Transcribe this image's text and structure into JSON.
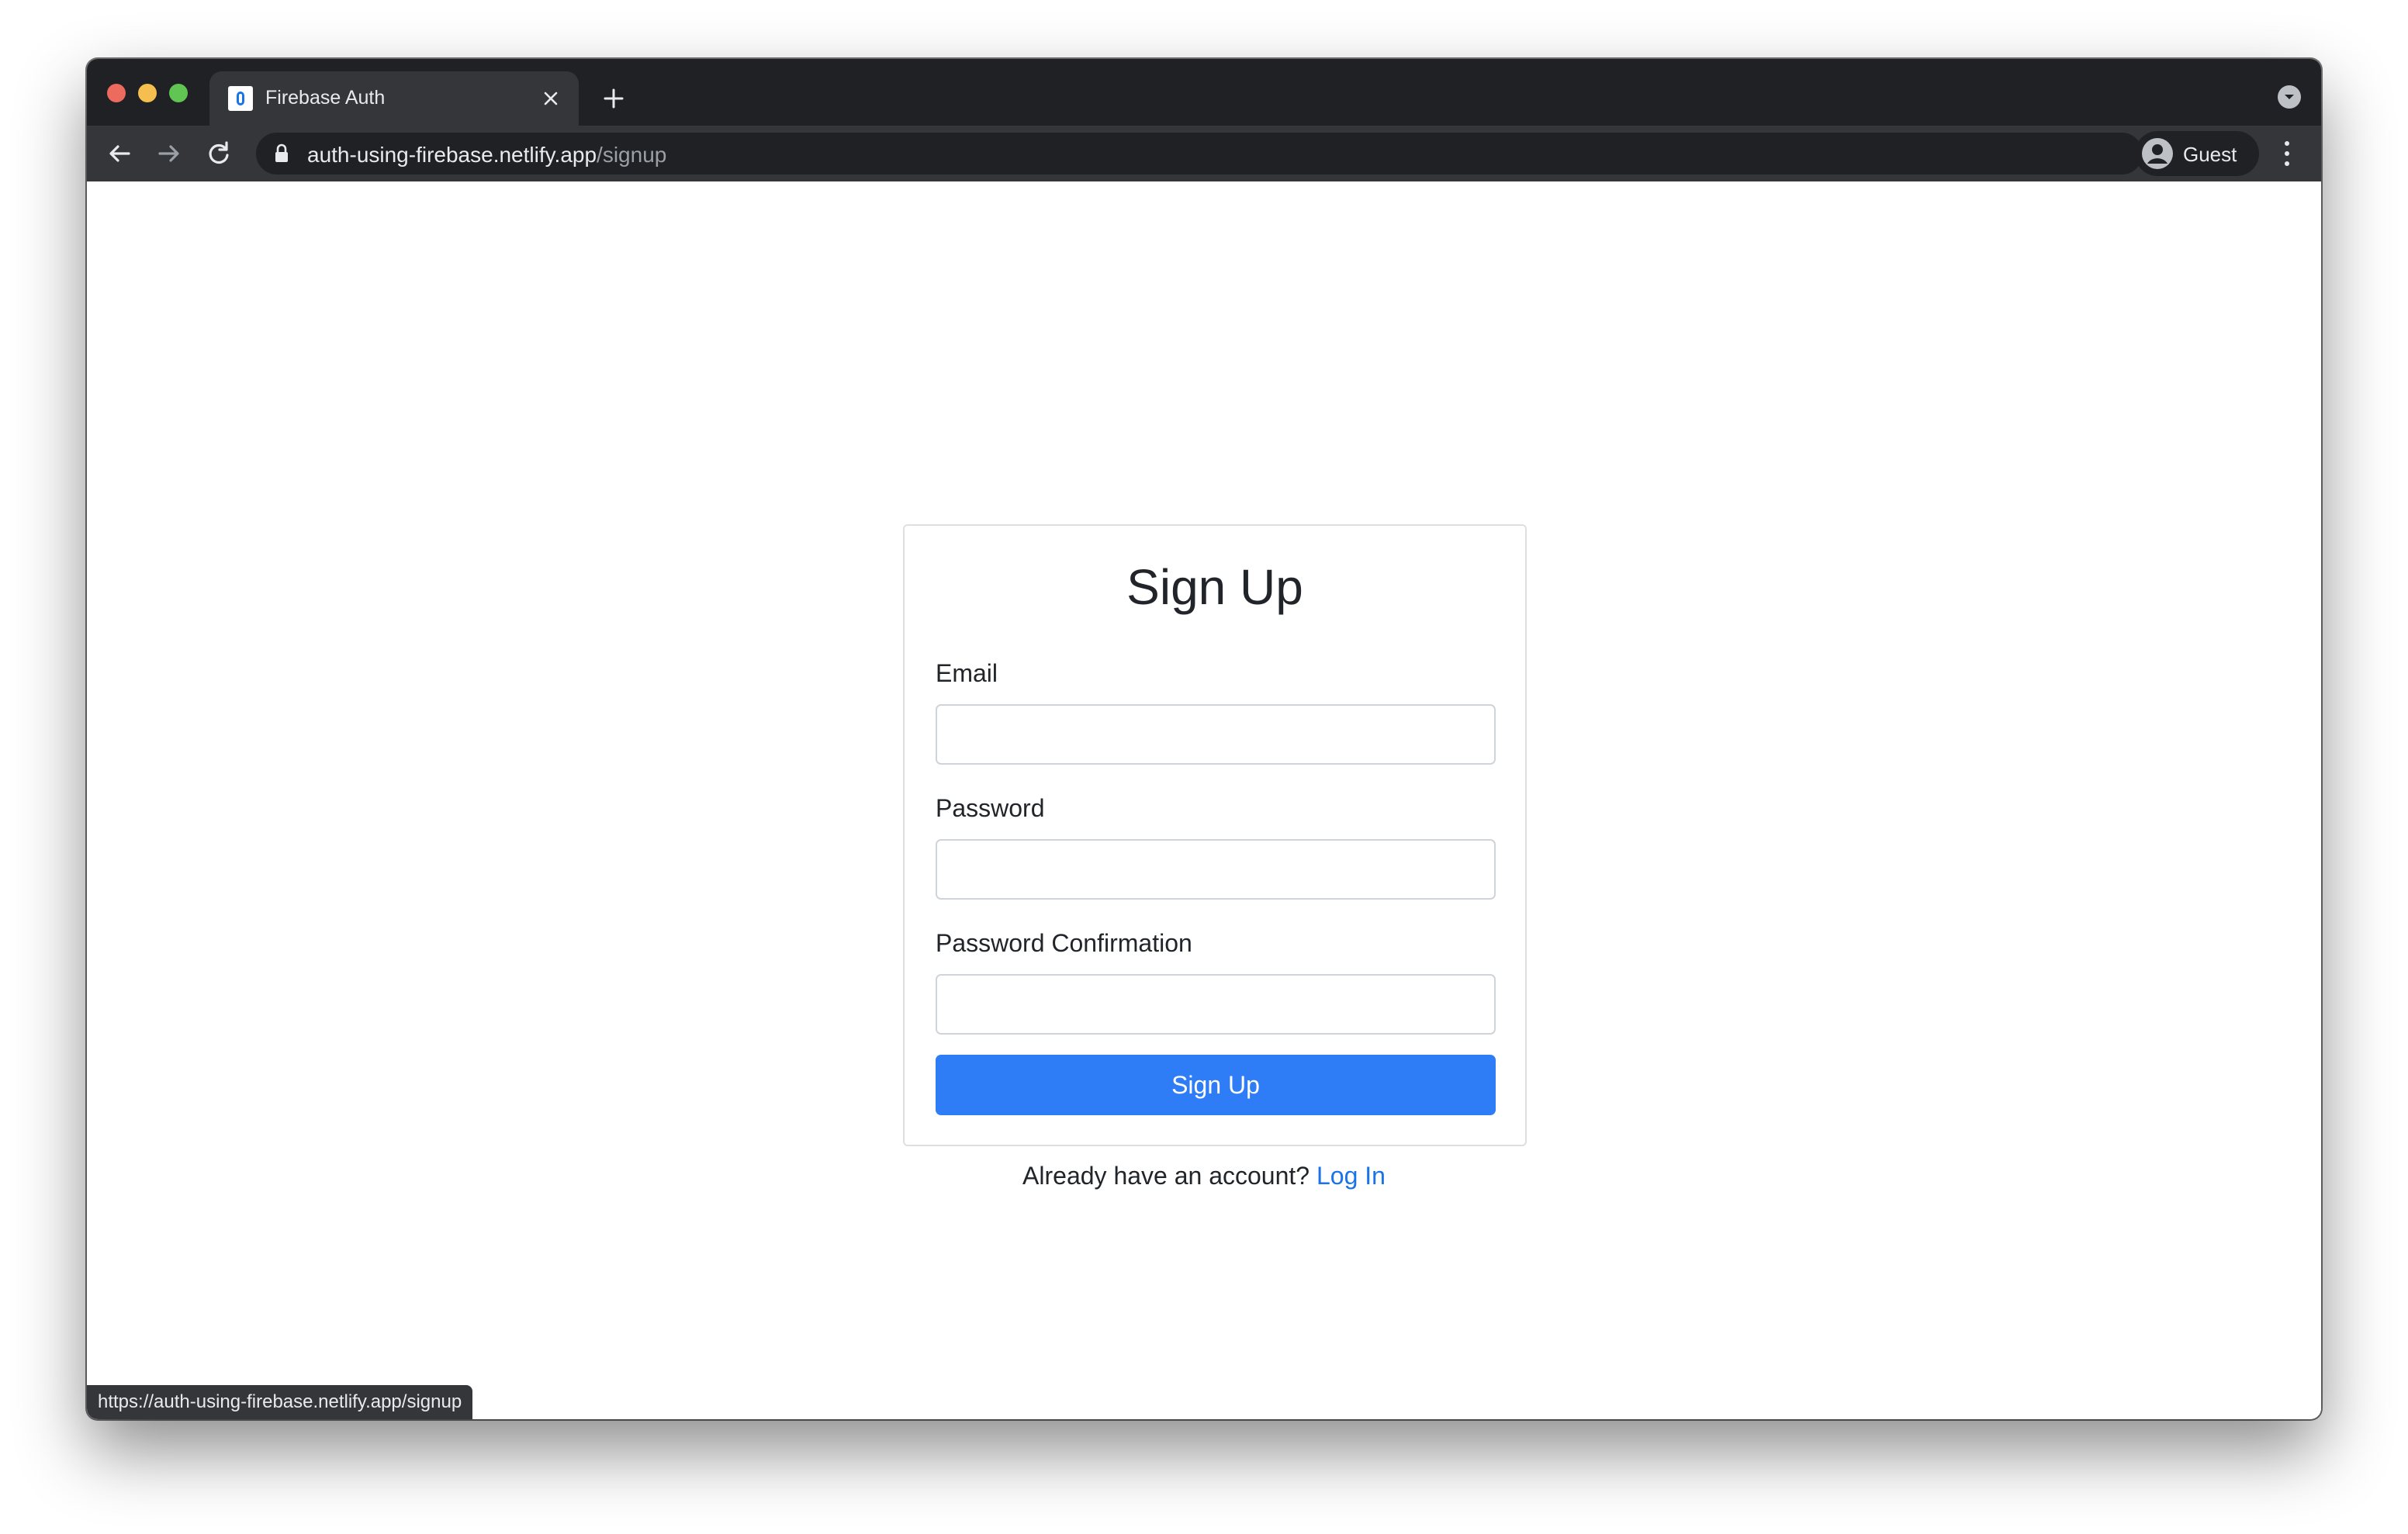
{
  "browser": {
    "tab": {
      "title": "Firebase Auth",
      "favicon": "firebase-favicon-icon"
    },
    "omnibox": {
      "host": "auth-using-firebase.netlify.app",
      "path": "/signup"
    },
    "profile": {
      "label": "Guest"
    },
    "status_url": "https://auth-using-firebase.netlify.app/signup"
  },
  "form": {
    "title": "Sign Up",
    "fields": [
      {
        "label": "Email",
        "value": ""
      },
      {
        "label": "Password",
        "value": ""
      },
      {
        "label": "Password Confirmation",
        "value": ""
      }
    ],
    "submit_label": "Sign Up"
  },
  "footer": {
    "prompt": "Already have an account?",
    "link_label": "Log In"
  },
  "colors": {
    "primary_button": "#2f7df6",
    "link": "#1a73e8",
    "browser_frame": "#202124",
    "toolbar": "#35363a"
  }
}
